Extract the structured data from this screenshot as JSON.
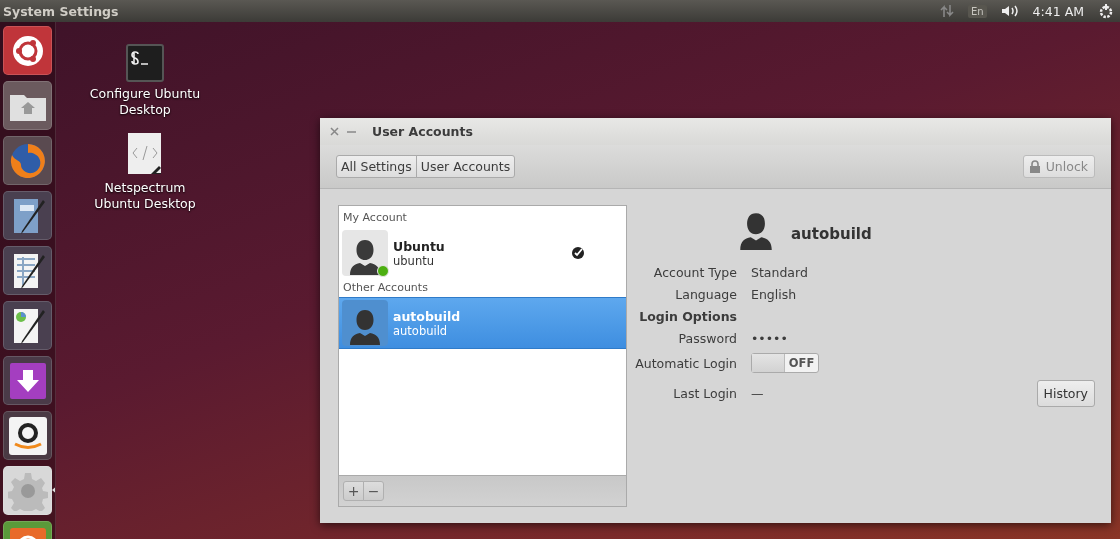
{
  "top_bar": {
    "title": "System Settings",
    "keyboard": "En",
    "clock": "4:41 AM"
  },
  "launcher": [
    {
      "kind": "ubuntu",
      "active": false
    },
    {
      "kind": "files",
      "active": false
    },
    {
      "kind": "browser",
      "active": false
    },
    {
      "kind": "writer",
      "active": false
    },
    {
      "kind": "calc",
      "active": false
    },
    {
      "kind": "impress",
      "active": false
    },
    {
      "kind": "software",
      "active": false
    },
    {
      "kind": "amazon",
      "active": false
    },
    {
      "kind": "settings",
      "active": true
    },
    {
      "kind": "updater",
      "active": false
    }
  ],
  "desktop_icons": [
    {
      "kind": "terminal",
      "label": "Configure Ubuntu Desktop"
    },
    {
      "kind": "script",
      "label": "Netspectrum Ubuntu Desktop"
    }
  ],
  "window": {
    "title": "User Accounts",
    "breadcrumbs": [
      {
        "label": "All Settings"
      },
      {
        "label": "User Accounts"
      }
    ],
    "unlock_button": "Unlock",
    "sections": [
      {
        "heading": "My Account",
        "users": [
          {
            "name": "Ubuntu",
            "username": "ubuntu",
            "online": true,
            "logged_in": true,
            "selected": false
          }
        ]
      },
      {
        "heading": "Other Accounts",
        "users": [
          {
            "name": "autobuild",
            "username": "autobuild",
            "online": false,
            "logged_in": false,
            "selected": true
          }
        ]
      }
    ],
    "list_buttons": [
      "+",
      "−"
    ],
    "detail": {
      "name": "autobuild",
      "rows": [
        {
          "kind": "text",
          "label": "Account Type",
          "value": "Standard"
        },
        {
          "kind": "text",
          "label": "Language",
          "value": "English"
        },
        {
          "kind": "heading",
          "label": "Login Options"
        },
        {
          "kind": "text",
          "label": "Password",
          "value": "•••••"
        },
        {
          "kind": "switch",
          "label": "Automatic Login",
          "value": "OFF",
          "on": false
        },
        {
          "kind": "text",
          "label": "Last Login",
          "value": "—",
          "button": "History"
        }
      ]
    }
  }
}
